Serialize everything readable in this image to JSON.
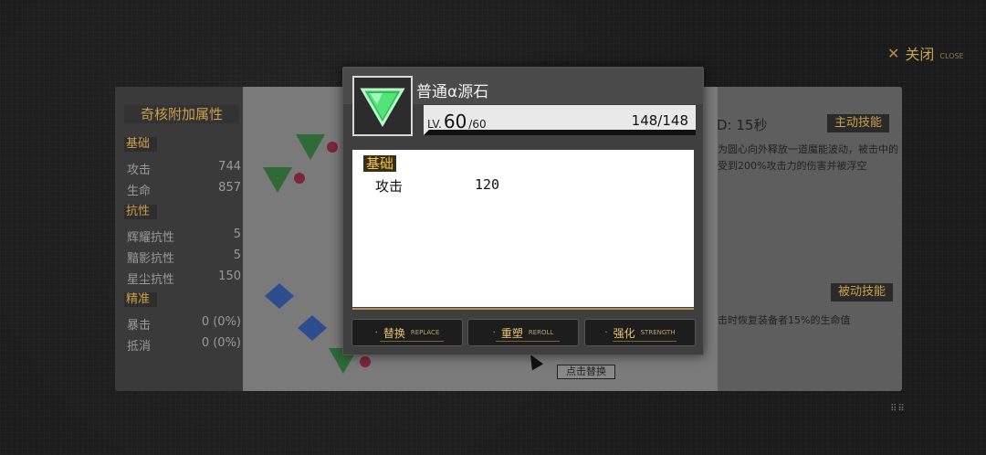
{
  "header": {
    "close_cn": "关闭",
    "close_en": "CLOSE"
  },
  "left_panel": {
    "title": "奇核附加属性",
    "sections": [
      {
        "label": "基础",
        "rows": [
          {
            "name": "攻击",
            "value": "744"
          },
          {
            "name": "生命",
            "value": "857"
          }
        ]
      },
      {
        "label": "抗性",
        "rows": [
          {
            "name": "辉耀抗性",
            "value": "5"
          },
          {
            "name": "黯影抗性",
            "value": "5"
          },
          {
            "name": "星尘抗性",
            "value": "150"
          }
        ]
      },
      {
        "label": "精准",
        "rows": [
          {
            "name": "暴击",
            "value": "0 (0%)"
          },
          {
            "name": "抵消",
            "value": "0 (0%)"
          }
        ]
      }
    ]
  },
  "right_panel": {
    "cooldown": "D: 15秒",
    "active_tag": "主动技能",
    "active_desc_1": "为圆心向外释放一道魔能波动，被击中的",
    "active_desc_2": "受到200%攻击力的伤害并被浮空",
    "passive_tag": "被动技能",
    "passive_desc": "击时恢复装备者15%的生命值"
  },
  "hint": "点击替换",
  "modal": {
    "name": "普通α源石",
    "lv_prefix": "LV.",
    "lv": "60",
    "lv_max": "/60",
    "hp": "148/148",
    "section": "基础",
    "stat_name": "攻击",
    "stat_value": "120",
    "buttons": [
      {
        "cn": "替换",
        "en": "REPLACE"
      },
      {
        "cn": "重塑",
        "en": "REROLL"
      },
      {
        "cn": "强化",
        "en": "STRENGTH"
      }
    ]
  },
  "colors": {
    "gold": "#c9a24a",
    "gem_green": "#3fd46a"
  }
}
